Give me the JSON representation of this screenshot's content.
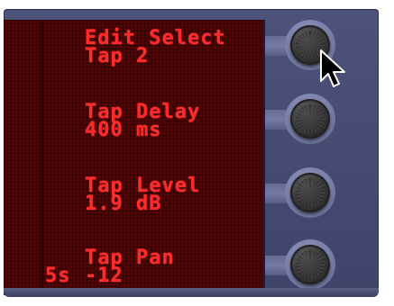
{
  "display": {
    "rows": [
      {
        "name": "Edit Select",
        "value": "Tap 2"
      },
      {
        "name": "Tap Delay",
        "value": "400 ms"
      },
      {
        "name": "Tap Level",
        "value": "1.9 dB"
      },
      {
        "name": "Tap Pan",
        "value": "-12"
      }
    ],
    "side_label": "5s"
  },
  "knobs": [
    {
      "icon": "rotary-knob-icon"
    },
    {
      "icon": "rotary-knob-icon"
    },
    {
      "icon": "rotary-knob-icon"
    },
    {
      "icon": "rotary-knob-icon"
    }
  ],
  "colors": {
    "lcd_background": "#5a0000",
    "lcd_text": "#ff2a2a",
    "panel": "#4d5278",
    "knob": "#3a3a3a"
  },
  "cursor": {
    "icon": "mouse-pointer-icon"
  }
}
